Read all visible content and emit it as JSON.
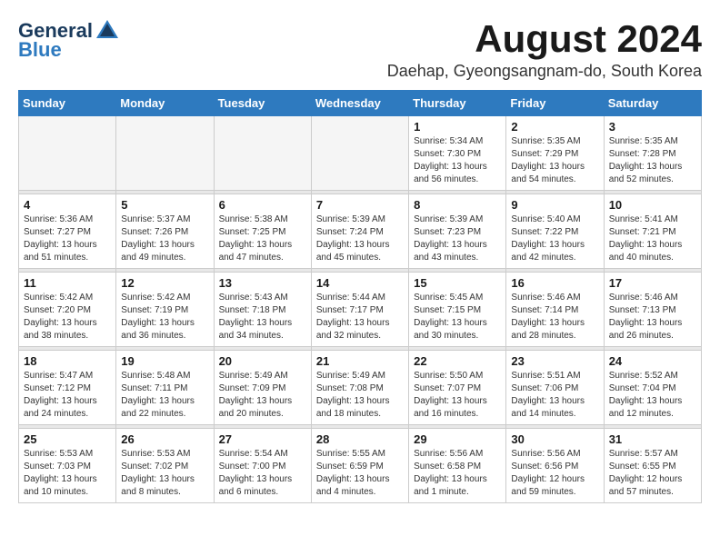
{
  "header": {
    "logo_general": "General",
    "logo_blue": "Blue",
    "month_year": "August 2024",
    "location": "Daehap, Gyeongsangnam-do, South Korea"
  },
  "weekdays": [
    "Sunday",
    "Monday",
    "Tuesday",
    "Wednesday",
    "Thursday",
    "Friday",
    "Saturday"
  ],
  "weeks": [
    [
      {
        "day": "",
        "info": ""
      },
      {
        "day": "",
        "info": ""
      },
      {
        "day": "",
        "info": ""
      },
      {
        "day": "",
        "info": ""
      },
      {
        "day": "1",
        "info": "Sunrise: 5:34 AM\nSunset: 7:30 PM\nDaylight: 13 hours\nand 56 minutes."
      },
      {
        "day": "2",
        "info": "Sunrise: 5:35 AM\nSunset: 7:29 PM\nDaylight: 13 hours\nand 54 minutes."
      },
      {
        "day": "3",
        "info": "Sunrise: 5:35 AM\nSunset: 7:28 PM\nDaylight: 13 hours\nand 52 minutes."
      }
    ],
    [
      {
        "day": "4",
        "info": "Sunrise: 5:36 AM\nSunset: 7:27 PM\nDaylight: 13 hours\nand 51 minutes."
      },
      {
        "day": "5",
        "info": "Sunrise: 5:37 AM\nSunset: 7:26 PM\nDaylight: 13 hours\nand 49 minutes."
      },
      {
        "day": "6",
        "info": "Sunrise: 5:38 AM\nSunset: 7:25 PM\nDaylight: 13 hours\nand 47 minutes."
      },
      {
        "day": "7",
        "info": "Sunrise: 5:39 AM\nSunset: 7:24 PM\nDaylight: 13 hours\nand 45 minutes."
      },
      {
        "day": "8",
        "info": "Sunrise: 5:39 AM\nSunset: 7:23 PM\nDaylight: 13 hours\nand 43 minutes."
      },
      {
        "day": "9",
        "info": "Sunrise: 5:40 AM\nSunset: 7:22 PM\nDaylight: 13 hours\nand 42 minutes."
      },
      {
        "day": "10",
        "info": "Sunrise: 5:41 AM\nSunset: 7:21 PM\nDaylight: 13 hours\nand 40 minutes."
      }
    ],
    [
      {
        "day": "11",
        "info": "Sunrise: 5:42 AM\nSunset: 7:20 PM\nDaylight: 13 hours\nand 38 minutes."
      },
      {
        "day": "12",
        "info": "Sunrise: 5:42 AM\nSunset: 7:19 PM\nDaylight: 13 hours\nand 36 minutes."
      },
      {
        "day": "13",
        "info": "Sunrise: 5:43 AM\nSunset: 7:18 PM\nDaylight: 13 hours\nand 34 minutes."
      },
      {
        "day": "14",
        "info": "Sunrise: 5:44 AM\nSunset: 7:17 PM\nDaylight: 13 hours\nand 32 minutes."
      },
      {
        "day": "15",
        "info": "Sunrise: 5:45 AM\nSunset: 7:15 PM\nDaylight: 13 hours\nand 30 minutes."
      },
      {
        "day": "16",
        "info": "Sunrise: 5:46 AM\nSunset: 7:14 PM\nDaylight: 13 hours\nand 28 minutes."
      },
      {
        "day": "17",
        "info": "Sunrise: 5:46 AM\nSunset: 7:13 PM\nDaylight: 13 hours\nand 26 minutes."
      }
    ],
    [
      {
        "day": "18",
        "info": "Sunrise: 5:47 AM\nSunset: 7:12 PM\nDaylight: 13 hours\nand 24 minutes."
      },
      {
        "day": "19",
        "info": "Sunrise: 5:48 AM\nSunset: 7:11 PM\nDaylight: 13 hours\nand 22 minutes."
      },
      {
        "day": "20",
        "info": "Sunrise: 5:49 AM\nSunset: 7:09 PM\nDaylight: 13 hours\nand 20 minutes."
      },
      {
        "day": "21",
        "info": "Sunrise: 5:49 AM\nSunset: 7:08 PM\nDaylight: 13 hours\nand 18 minutes."
      },
      {
        "day": "22",
        "info": "Sunrise: 5:50 AM\nSunset: 7:07 PM\nDaylight: 13 hours\nand 16 minutes."
      },
      {
        "day": "23",
        "info": "Sunrise: 5:51 AM\nSunset: 7:06 PM\nDaylight: 13 hours\nand 14 minutes."
      },
      {
        "day": "24",
        "info": "Sunrise: 5:52 AM\nSunset: 7:04 PM\nDaylight: 13 hours\nand 12 minutes."
      }
    ],
    [
      {
        "day": "25",
        "info": "Sunrise: 5:53 AM\nSunset: 7:03 PM\nDaylight: 13 hours\nand 10 minutes."
      },
      {
        "day": "26",
        "info": "Sunrise: 5:53 AM\nSunset: 7:02 PM\nDaylight: 13 hours\nand 8 minutes."
      },
      {
        "day": "27",
        "info": "Sunrise: 5:54 AM\nSunset: 7:00 PM\nDaylight: 13 hours\nand 6 minutes."
      },
      {
        "day": "28",
        "info": "Sunrise: 5:55 AM\nSunset: 6:59 PM\nDaylight: 13 hours\nand 4 minutes."
      },
      {
        "day": "29",
        "info": "Sunrise: 5:56 AM\nSunset: 6:58 PM\nDaylight: 13 hours\nand 1 minute."
      },
      {
        "day": "30",
        "info": "Sunrise: 5:56 AM\nSunset: 6:56 PM\nDaylight: 12 hours\nand 59 minutes."
      },
      {
        "day": "31",
        "info": "Sunrise: 5:57 AM\nSunset: 6:55 PM\nDaylight: 12 hours\nand 57 minutes."
      }
    ]
  ]
}
